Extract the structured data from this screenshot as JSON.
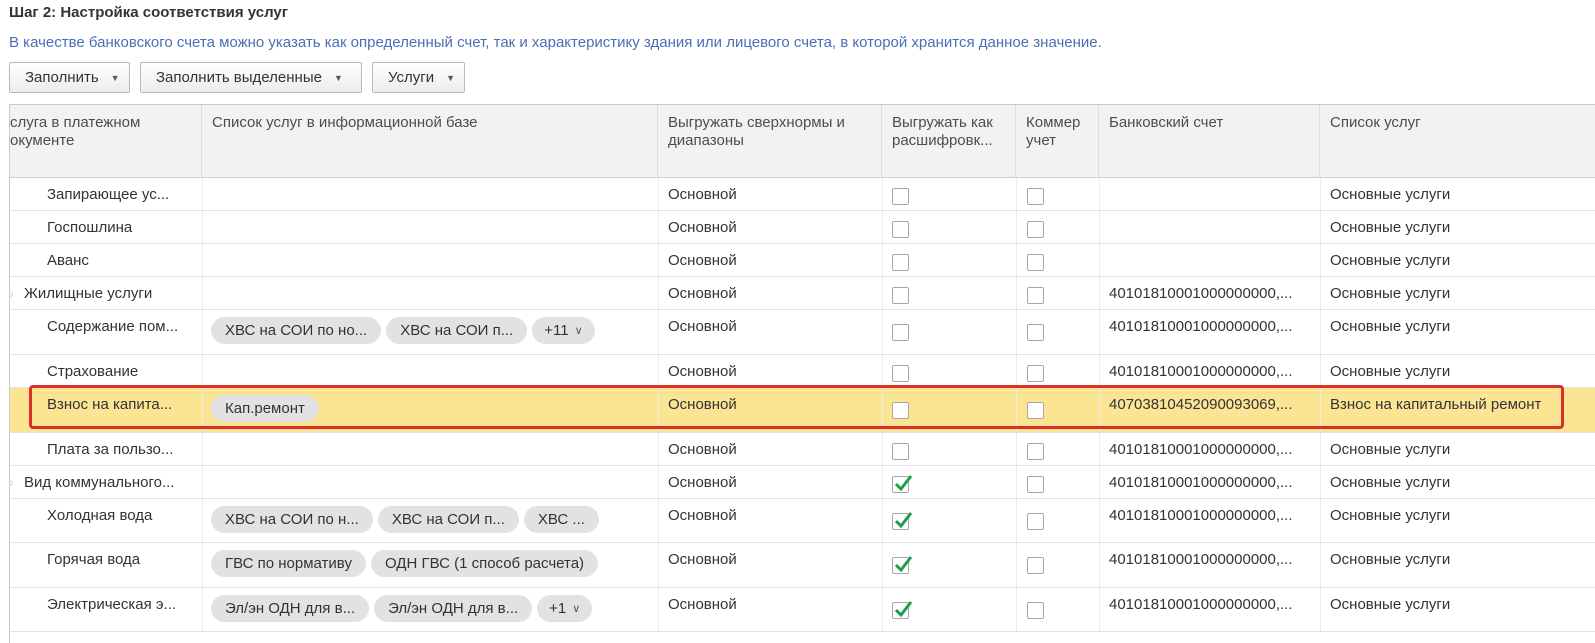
{
  "step_title": "Шаг 2: Настройка соответствия услуг",
  "hint": "В качестве банковского счета можно указать как определенный счет, так и характеристику здания или лицевого счета, в которой хранится данное значение.",
  "toolbar": {
    "fill": "Заполнить",
    "fill_selected": "Заполнить выделенные",
    "services": "Услуги"
  },
  "columns": [
    "слуга в платежном окументе",
    "Список услуг в информационной базе",
    "Выгружать сверхнормы и диапазоны",
    "Выгружать как расшифровк...",
    "Коммер учет",
    "Банковский счет",
    "Список услуг"
  ],
  "rows": [
    {
      "name": "Запирающее ус...",
      "chips": [],
      "more": "",
      "mode": "Основной",
      "export": false,
      "commerce": false,
      "account": "",
      "list": "Основные услуги"
    },
    {
      "name": "Госпошлина",
      "chips": [],
      "more": "",
      "mode": "Основной",
      "export": false,
      "commerce": false,
      "account": "",
      "list": "Основные услуги"
    },
    {
      "name": "Аванс",
      "chips": [],
      "more": "",
      "mode": "Основной",
      "export": false,
      "commerce": false,
      "account": "",
      "list": "Основные услуги"
    },
    {
      "name": "Жилищные услуги",
      "chips": [],
      "more": "",
      "mode": "Основной",
      "export": false,
      "commerce": false,
      "account": "40101810001000000000,...",
      "list": "Основные услуги"
    },
    {
      "name": "Содержание пом...",
      "chips": [
        "ХВС на СОИ по но...",
        "ХВС на СОИ п..."
      ],
      "more": "+11",
      "mode": "Основной",
      "export": false,
      "commerce": false,
      "account": "40101810001000000000,...",
      "list": "Основные услуги"
    },
    {
      "name": "Страхование",
      "chips": [],
      "more": "",
      "mode": "Основной",
      "export": false,
      "commerce": false,
      "account": "40101810001000000000,...",
      "list": "Основные услуги"
    },
    {
      "name": "Взнос на капита...",
      "chips": [
        "Кап.ремонт"
      ],
      "more": "",
      "mode": "Основной",
      "export": false,
      "commerce": false,
      "account": "40703810452090093069,...",
      "list": "Взнос на капитальный ремонт"
    },
    {
      "name": "Плата за пользо...",
      "chips": [],
      "more": "",
      "mode": "Основной",
      "export": false,
      "commerce": false,
      "account": "40101810001000000000,...",
      "list": "Основные услуги"
    },
    {
      "name": "Вид коммунального...",
      "chips": [],
      "more": "",
      "mode": "Основной",
      "export": true,
      "commerce": false,
      "account": "40101810001000000000,...",
      "list": "Основные услуги"
    },
    {
      "name": "Холодная вода",
      "chips": [
        "ХВС на СОИ по н...",
        "ХВС на СОИ п...",
        "ХВС ..."
      ],
      "more": "",
      "mode": "Основной",
      "export": true,
      "commerce": false,
      "account": "40101810001000000000,...",
      "list": "Основные услуги"
    },
    {
      "name": "Горячая вода",
      "chips": [
        "ГВС по нормативу",
        "ОДН ГВС (1 способ расчета)"
      ],
      "more": "",
      "mode": "Основной",
      "export": true,
      "commerce": false,
      "account": "40101810001000000000,...",
      "list": "Основные услуги"
    },
    {
      "name": "Электрическая э...",
      "chips": [
        "Эл/эн ОДН для в...",
        "Эл/эн ОДН для в..."
      ],
      "more": "+1",
      "mode": "Основной",
      "export": true,
      "commerce": false,
      "account": "40101810001000000000,...",
      "list": "Основные услуги"
    }
  ],
  "selected_row": 6,
  "colors": {
    "accent": "#4a6fb5",
    "selection": "#fbe595",
    "highlight_border": "#d9302c",
    "check": "#1e9e4a"
  }
}
